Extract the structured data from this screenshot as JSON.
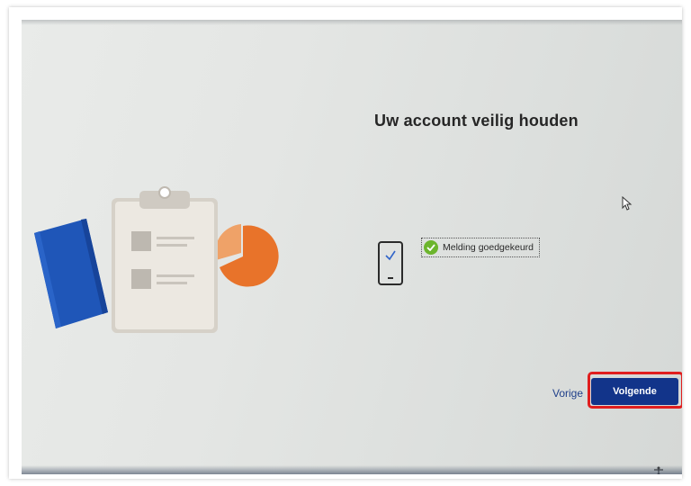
{
  "dialog": {
    "title": "Uw account veilig houden",
    "status_text": "Melding goedgekeurd",
    "back_label": "Vorige",
    "next_label": "Volgende"
  },
  "icons": {
    "illustration": [
      "notebook-icon",
      "clipboard-icon",
      "pie-chart-icon"
    ],
    "phone": "phone-icon",
    "check": "check-circle-icon",
    "cursor": "mouse-cursor-icon",
    "taskbar": "accessibility-icon"
  },
  "colors": {
    "accent_button": "#12348a",
    "check_green": "#6cb52d",
    "highlight_red": "#e01e1e",
    "link_blue": "#1f3f8a",
    "notebook_blue": "#1f56b8",
    "pie_orange": "#e8732a"
  }
}
